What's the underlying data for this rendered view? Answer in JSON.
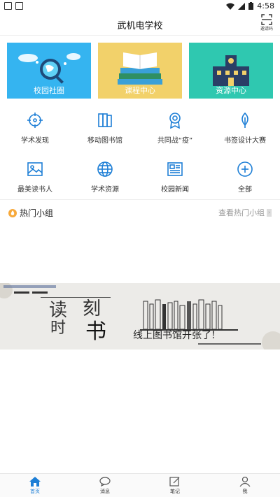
{
  "status_bar": {
    "time": "4:58"
  },
  "header": {
    "title": "武机电学校",
    "scan_label": "邀请码"
  },
  "cards": [
    {
      "label": "校园社圈",
      "color": "#35b4f0"
    },
    {
      "label": "课程中心",
      "color": "#f2d16a"
    },
    {
      "label": "资源中心",
      "color": "#2fc8b0"
    }
  ],
  "grid": [
    {
      "label": "学术发现",
      "icon": "crosshair-icon"
    },
    {
      "label": "移动图书馆",
      "icon": "book-icon"
    },
    {
      "label": "共同战“疫”",
      "icon": "medal-icon"
    },
    {
      "label": "书签设计大赛",
      "icon": "leaf-icon"
    },
    {
      "label": "最美读书人",
      "icon": "image-icon"
    },
    {
      "label": "学术资源",
      "icon": "globe-icon"
    },
    {
      "label": "校园新闻",
      "icon": "newspaper-icon"
    },
    {
      "label": "全部",
      "icon": "plus-circle-icon"
    }
  ],
  "hot_groups": {
    "title": "热门小组",
    "more": "查看热门小组"
  },
  "banner": {
    "headline": "线上图书馆开张了!",
    "big_chars": [
      "读",
      "刻",
      "时",
      "书"
    ]
  },
  "tabbar": [
    {
      "label": "首页",
      "icon": "home-icon"
    },
    {
      "label": "消息",
      "icon": "chat-icon"
    },
    {
      "label": "笔记",
      "icon": "note-icon"
    },
    {
      "label": "我",
      "icon": "user-icon"
    }
  ],
  "accent_color": "#1e7fd6"
}
